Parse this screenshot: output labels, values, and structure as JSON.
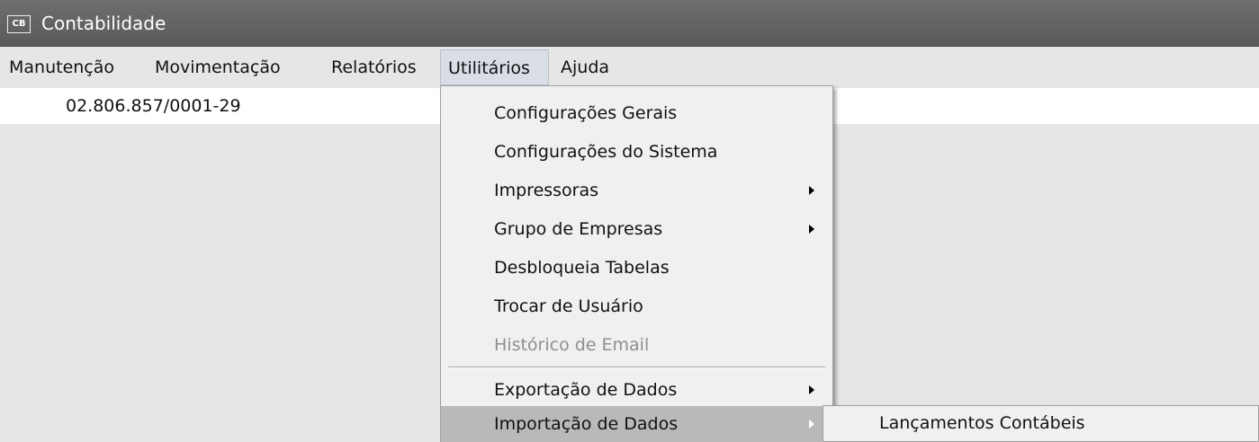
{
  "window": {
    "title": "Contabilidade",
    "icon_text": "CB",
    "icon_name": "app-logo-icon"
  },
  "menubar": {
    "items": [
      {
        "label": "Manutenção"
      },
      {
        "label": "Movimentação"
      },
      {
        "label": "Relatórios"
      },
      {
        "label": "Utilitários",
        "active": true
      },
      {
        "label": "Ajuda"
      }
    ]
  },
  "info": {
    "cnpj": "02.806.857/0001-29"
  },
  "utilitarios_menu": {
    "items": [
      {
        "label": "Configurações Gerais"
      },
      {
        "label": "Configurações do Sistema"
      },
      {
        "label": "Impressoras",
        "submenu": true
      },
      {
        "label": "Grupo de Empresas",
        "submenu": true
      },
      {
        "label": "Desbloqueia Tabelas"
      },
      {
        "label": "Trocar de Usuário"
      },
      {
        "label": "Histórico de Email",
        "disabled": true
      },
      {
        "label": "Exportação de Dados",
        "submenu": true
      },
      {
        "label": "Importação de Dados",
        "submenu": true,
        "highlighted": true
      }
    ]
  },
  "importacao_submenu": {
    "items": [
      {
        "label": "Lançamentos Contábeis"
      }
    ]
  },
  "colors": {
    "titlebar": "#5f5f5f",
    "menu_highlight": "#b9b9b9",
    "disabled_text": "#8f8f8f"
  }
}
